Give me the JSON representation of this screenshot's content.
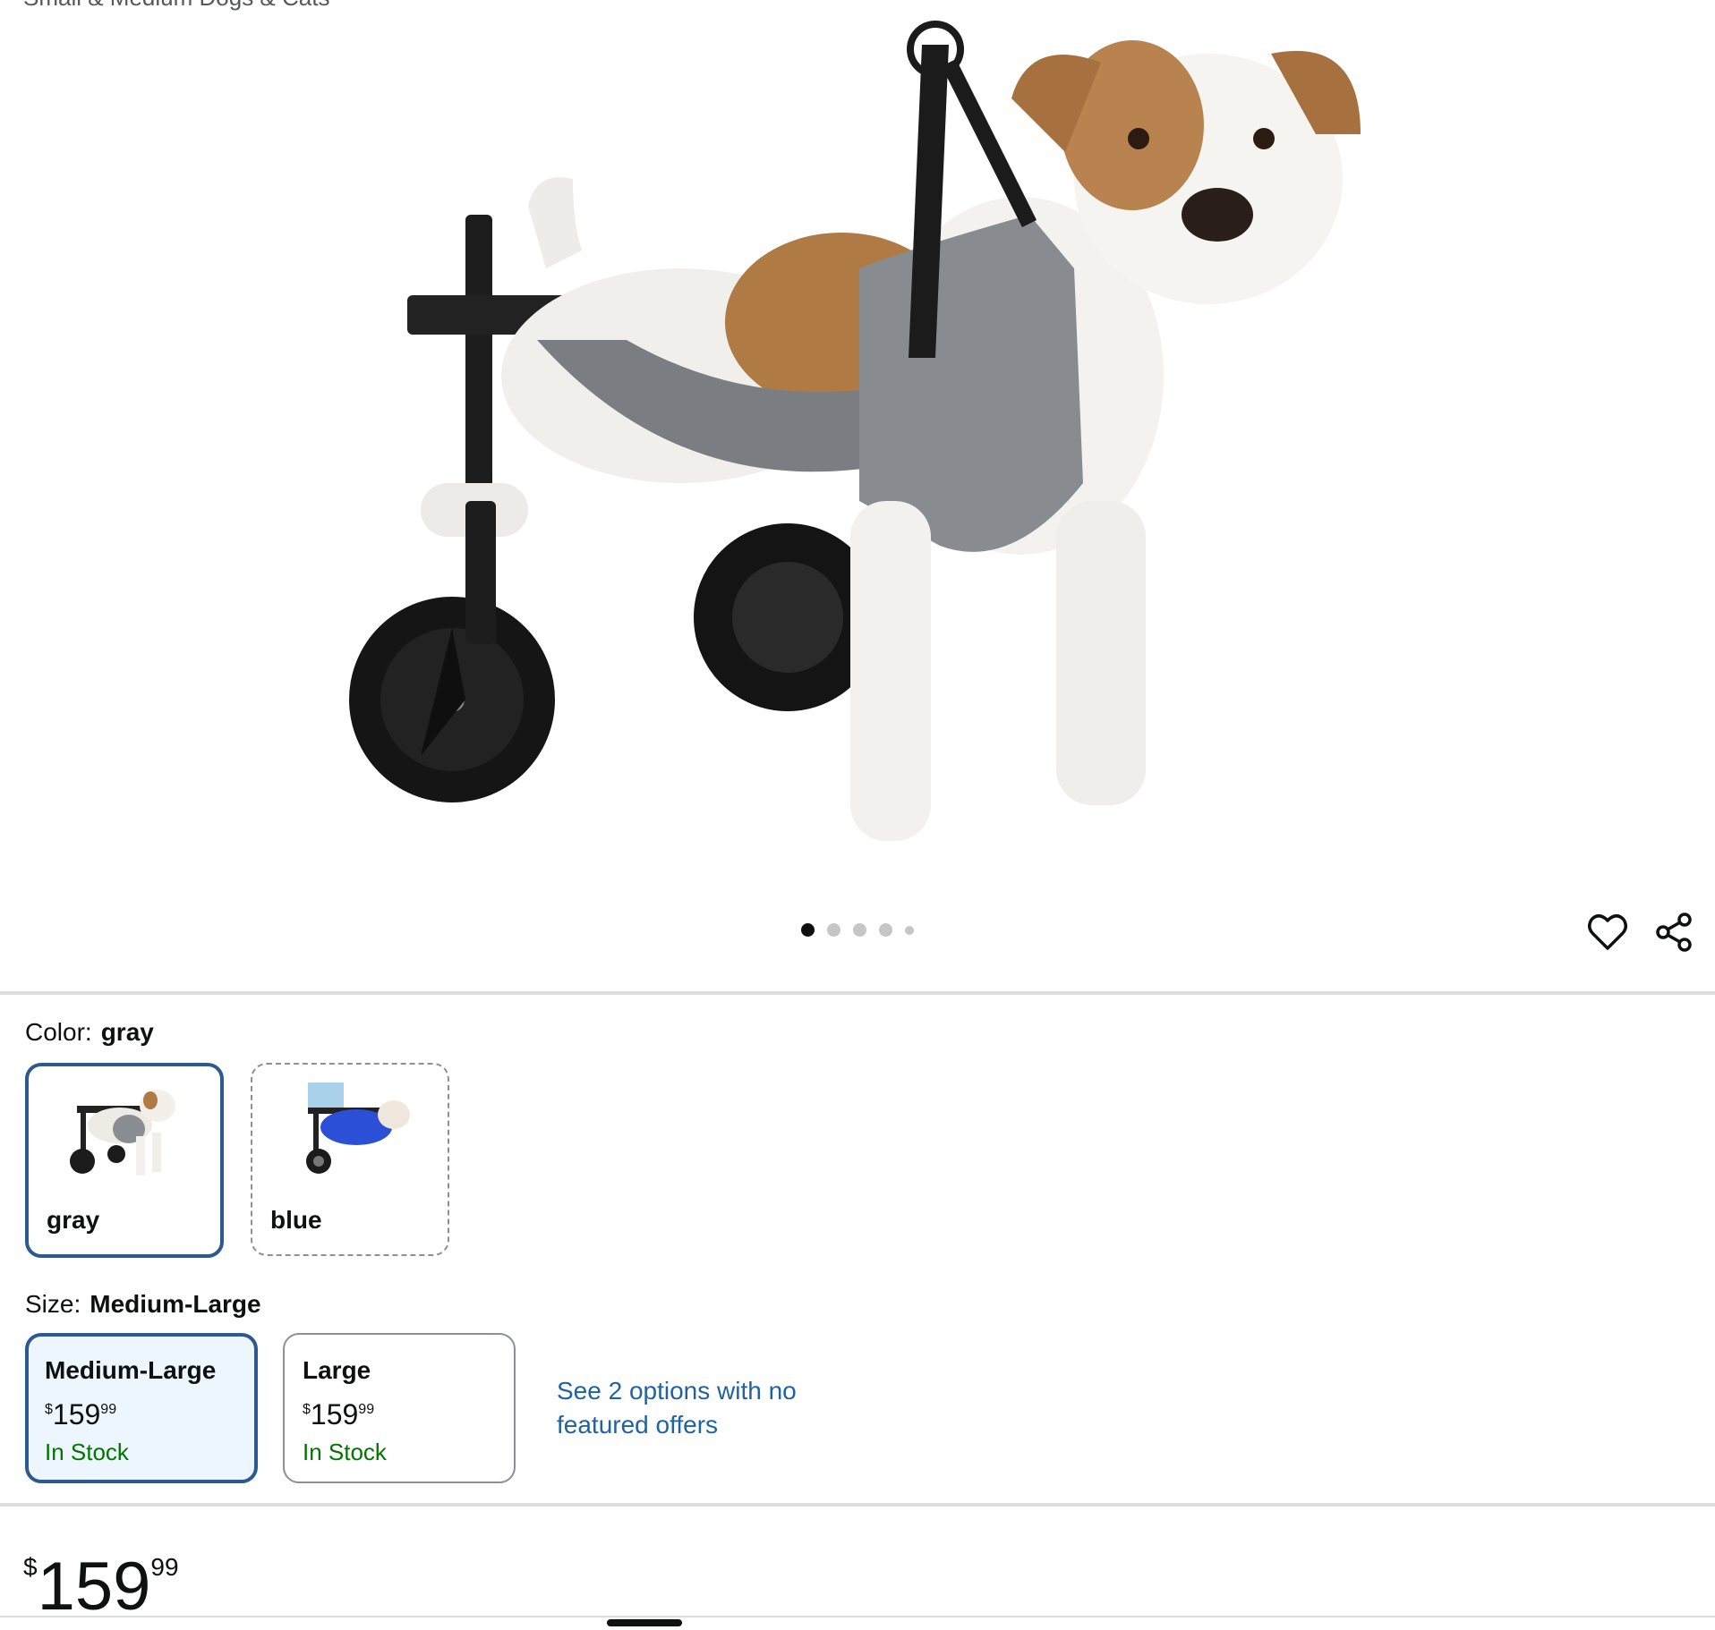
{
  "header": {
    "title_fragment": "Small & Medium Dogs & Cats"
  },
  "gallery": {
    "dot_count": 5,
    "active_index": 0
  },
  "actions": {
    "wishlist_icon": "heart-icon",
    "share_icon": "share-icon"
  },
  "color": {
    "label": "Color:",
    "selected": "gray",
    "options": [
      {
        "name": "gray",
        "selected": true,
        "available": true
      },
      {
        "name": "blue",
        "selected": false,
        "available": false
      }
    ]
  },
  "size": {
    "label": "Size:",
    "selected": "Medium-Large",
    "options": [
      {
        "name": "Medium-Large",
        "currency": "$",
        "whole": "159",
        "fraction": "99",
        "stock": "In Stock",
        "selected": true
      },
      {
        "name": "Large",
        "currency": "$",
        "whole": "159",
        "fraction": "99",
        "stock": "In Stock",
        "selected": false
      }
    ],
    "more_link": "See 2 options with no featured offers"
  },
  "price": {
    "currency": "$",
    "whole": "159",
    "fraction": "99"
  },
  "colors": {
    "accent_border": "#2d5a8e",
    "selected_bg": "#edf6fd",
    "stock_green": "#007600",
    "link_blue": "#2162a1"
  }
}
